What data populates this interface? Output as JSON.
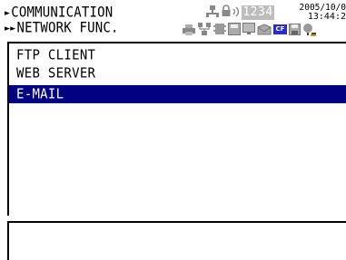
{
  "header": {
    "breadcrumb_level1": "COMMUNICATION",
    "breadcrumb_level2": "NETWORK FUNC.",
    "arrow1": "►",
    "arrow2": "►►",
    "counter": "1234",
    "date": "2005/10/0",
    "time": "13:44:2",
    "cf_badge": "CF",
    "status_icons": [
      "lan-icon",
      "lock-icon",
      "signal-icon",
      "printer-icon",
      "network-icon",
      "memory-icon",
      "display-icon",
      "email-icon",
      "cf-card-icon",
      "floppy-icon",
      "settings-icon"
    ]
  },
  "menu": {
    "items": [
      {
        "label": "FTP CLIENT",
        "selected": false
      },
      {
        "label": "WEB SERVER",
        "selected": false
      },
      {
        "label": "E-MAIL",
        "selected": true
      }
    ]
  },
  "message": {
    "text": ""
  },
  "colors": {
    "selection_bg": "#000080",
    "selection_fg": "#ffffff",
    "counter_bg": "#bdbdbd"
  }
}
